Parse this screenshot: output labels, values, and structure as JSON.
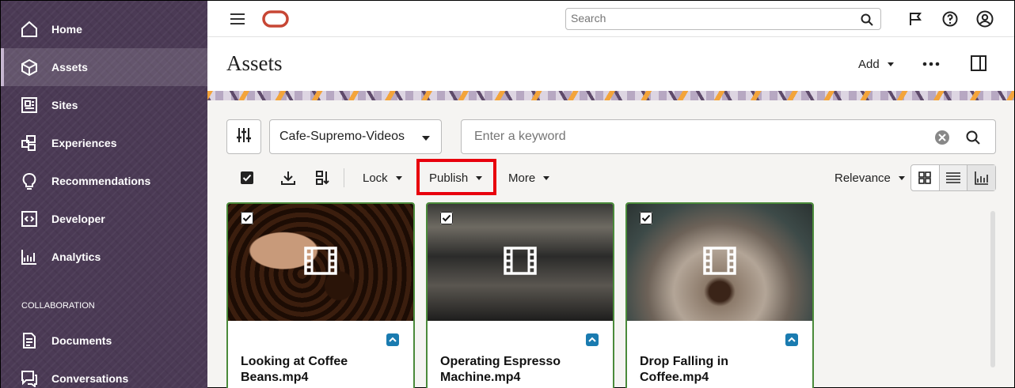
{
  "sidebar": {
    "items": [
      {
        "label": "Home",
        "icon": "home-icon"
      },
      {
        "label": "Assets",
        "icon": "cube-icon",
        "active": true
      },
      {
        "label": "Sites",
        "icon": "sites-icon"
      },
      {
        "label": "Experiences",
        "icon": "experiences-icon"
      },
      {
        "label": "Recommendations",
        "icon": "lightbulb-icon"
      },
      {
        "label": "Developer",
        "icon": "code-icon"
      },
      {
        "label": "Analytics",
        "icon": "chart-icon"
      }
    ],
    "section_label": "COLLABORATION",
    "collab_items": [
      {
        "label": "Documents",
        "icon": "document-icon"
      },
      {
        "label": "Conversations",
        "icon": "conversation-icon"
      }
    ]
  },
  "topbar": {
    "search_placeholder": "Search"
  },
  "page": {
    "title": "Assets",
    "add_label": "Add"
  },
  "filters": {
    "repository": "Cafe-Supremo-Videos",
    "keyword_placeholder": "Enter a keyword"
  },
  "toolbar": {
    "lock_label": "Lock",
    "publish_label": "Publish",
    "more_label": "More",
    "sort_label": "Relevance"
  },
  "cards": [
    {
      "title": "Looking at Coffee Beans.mp4",
      "selected": true
    },
    {
      "title": "Operating Espresso Machine.mp4",
      "selected": true
    },
    {
      "title": "Drop Falling in Coffee.mp4",
      "selected": true
    }
  ],
  "colors": {
    "sidebar_bg": "#4b3a55",
    "card_border": "#4a8a3a",
    "highlight": "#e8000d",
    "brand": "#c74634"
  }
}
